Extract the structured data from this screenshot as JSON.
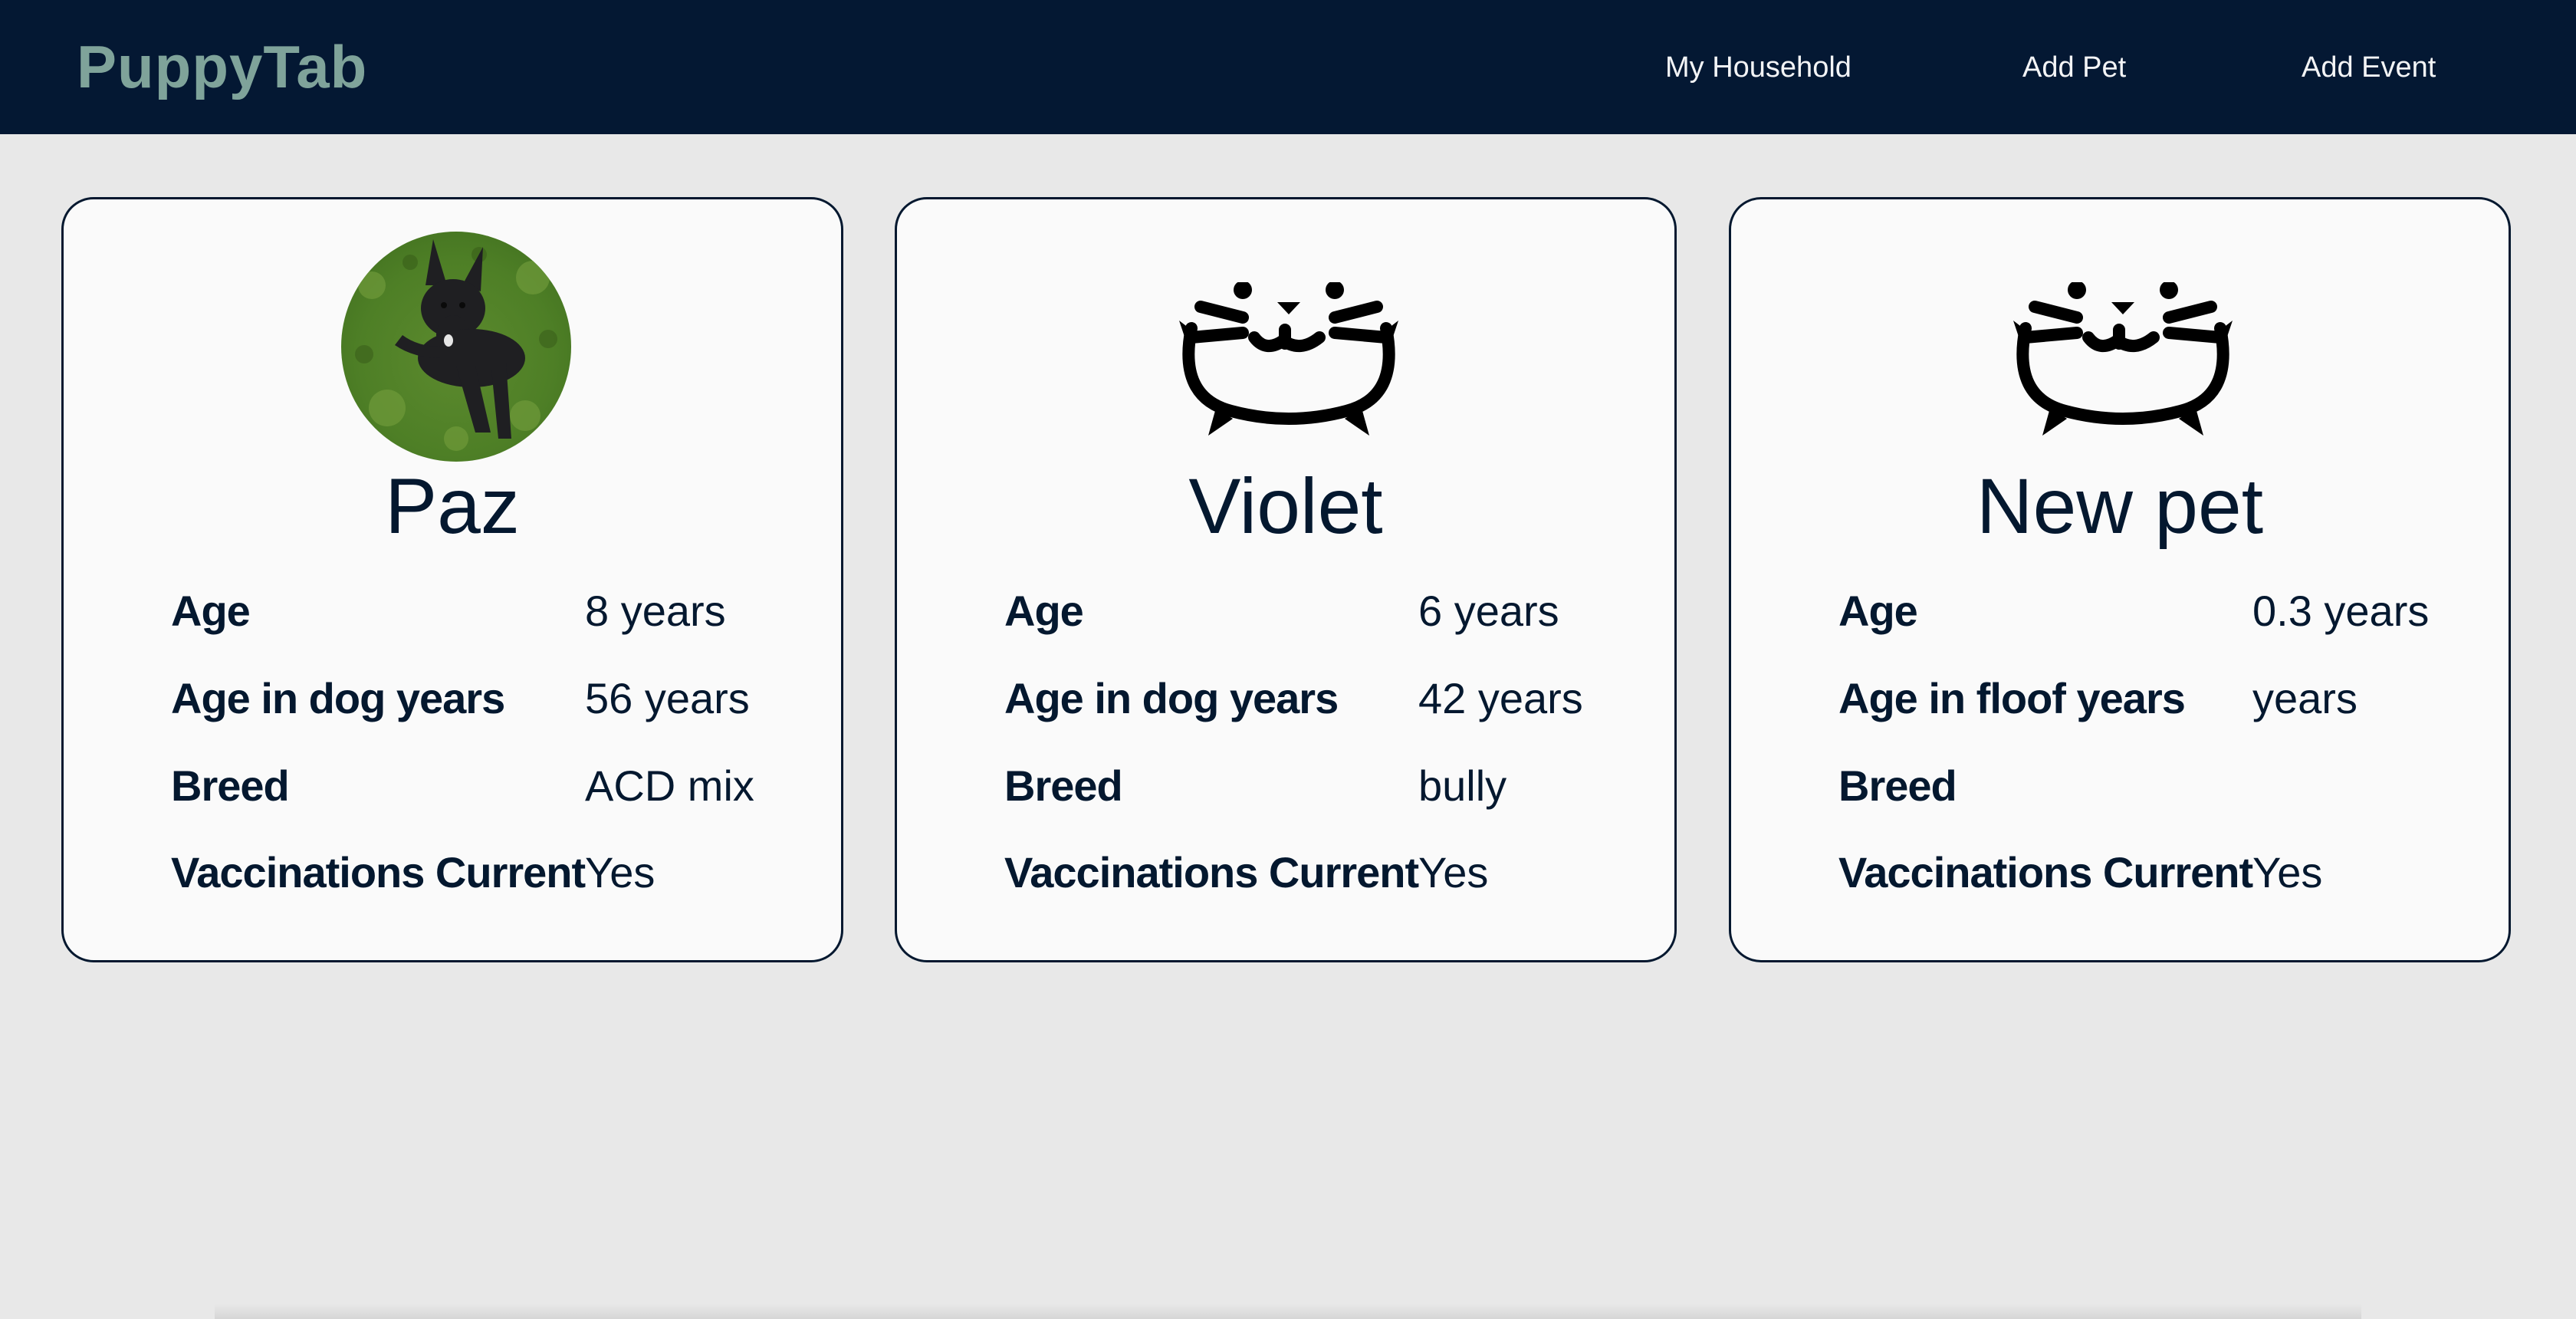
{
  "navbar": {
    "brand": "PuppyTab",
    "links": [
      "My Household",
      "Add Pet",
      "Add Event"
    ]
  },
  "colors": {
    "navbar_bg": "#041833",
    "brand": "#7fa39a",
    "page_bg": "#e8e8e8",
    "card_bg": "#fafafa",
    "text": "#04182f"
  },
  "pets": [
    {
      "name": "Paz",
      "image": "dog-photo",
      "fields": [
        {
          "label": "Age",
          "value": "8 years"
        },
        {
          "label": "Age in dog years",
          "value": "56 years"
        },
        {
          "label": "Breed",
          "value": "ACD mix"
        },
        {
          "label": "Vaccinations Current",
          "value": "Yes"
        }
      ]
    },
    {
      "name": "Violet",
      "image": "cat-face-icon",
      "fields": [
        {
          "label": "Age",
          "value": "6 years"
        },
        {
          "label": "Age in dog years",
          "value": "42 years"
        },
        {
          "label": "Breed",
          "value": "bully"
        },
        {
          "label": "Vaccinations Current",
          "value": "Yes"
        }
      ]
    },
    {
      "name": "New pet",
      "image": "cat-face-icon",
      "fields": [
        {
          "label": "Age",
          "value": "0.3 years"
        },
        {
          "label": "Age in floof years",
          "value": "years"
        },
        {
          "label": "Breed",
          "value": ""
        },
        {
          "label": "Vaccinations Current",
          "value": "Yes"
        }
      ]
    }
  ]
}
